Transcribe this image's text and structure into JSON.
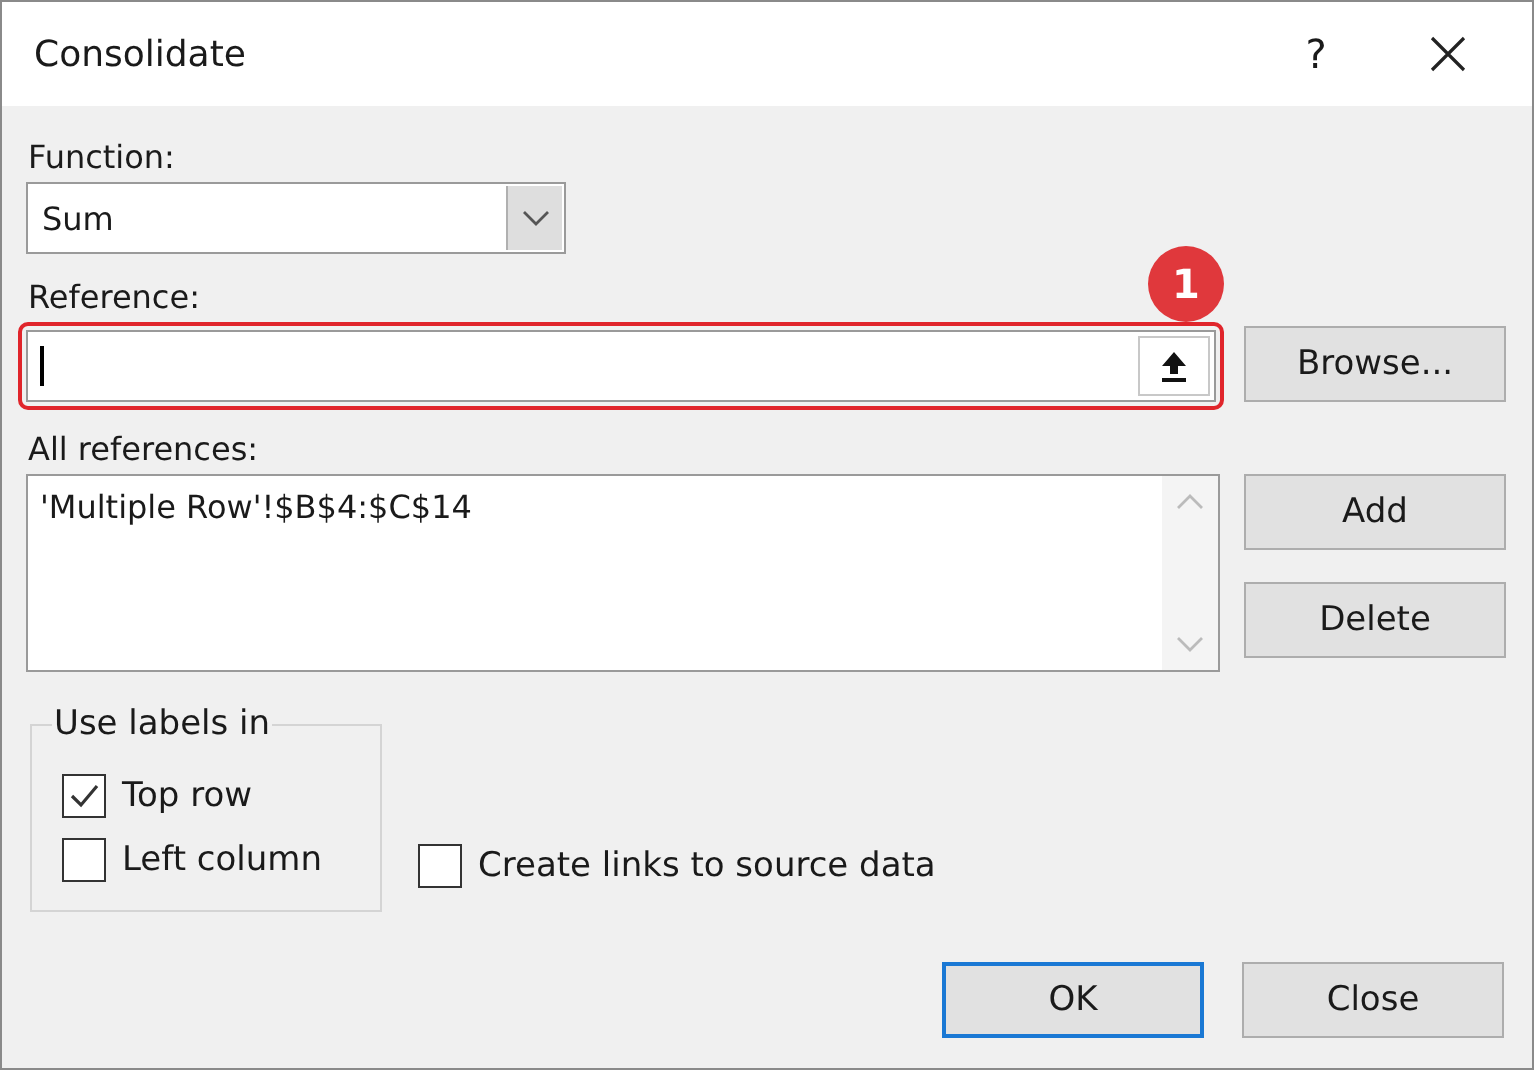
{
  "window": {
    "title": "Consolidate",
    "help": "?"
  },
  "function": {
    "label": "Function:",
    "value": "Sum"
  },
  "reference": {
    "label": "Reference:",
    "focused": true,
    "highlighted": true,
    "badge": "1"
  },
  "browse_button": "Browse...",
  "all_references": {
    "label": "All references:",
    "items": [
      "'Multiple Row'!$B$4:$C$14"
    ]
  },
  "add_button": "Add",
  "delete_button": "Delete",
  "use_labels": {
    "title": "Use labels in",
    "options": [
      {
        "label": "Top row",
        "checked": true
      },
      {
        "label": "Left column",
        "checked": false
      }
    ]
  },
  "create_links": {
    "label": "Create links to source data",
    "checked": false
  },
  "buttons": [
    {
      "label": "OK",
      "default": true
    },
    {
      "label": "Close",
      "default": false
    }
  ]
}
